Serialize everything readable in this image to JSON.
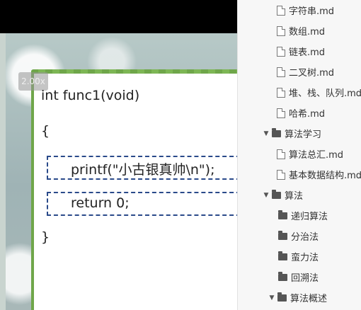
{
  "viewer": {
    "zoom": "2.00x",
    "code_lines": {
      "line1": "int func1(void)",
      "line2": "{",
      "line3": "printf(\"小古银真帅\\n\");",
      "line4": "return 0;",
      "line5": "}"
    }
  },
  "tree": {
    "items": [
      {
        "label": "字符串.md",
        "type": "file"
      },
      {
        "label": "数组.md",
        "type": "file"
      },
      {
        "label": "链表.md",
        "type": "file"
      },
      {
        "label": "二叉树.md",
        "type": "file"
      },
      {
        "label": "堆、栈、队列.md",
        "type": "file"
      },
      {
        "label": "哈希.md",
        "type": "file"
      },
      {
        "label": "算法学习",
        "type": "folder"
      },
      {
        "label": "算法总汇.md",
        "type": "file"
      },
      {
        "label": "基本数据结构.md",
        "type": "file"
      },
      {
        "label": "算法",
        "type": "folder"
      },
      {
        "label": "递归算法",
        "type": "folder"
      },
      {
        "label": "分治法",
        "type": "folder"
      },
      {
        "label": "蛮力法",
        "type": "folder"
      },
      {
        "label": "回溯法",
        "type": "folder"
      },
      {
        "label": "算法概述",
        "type": "folder"
      }
    ]
  }
}
